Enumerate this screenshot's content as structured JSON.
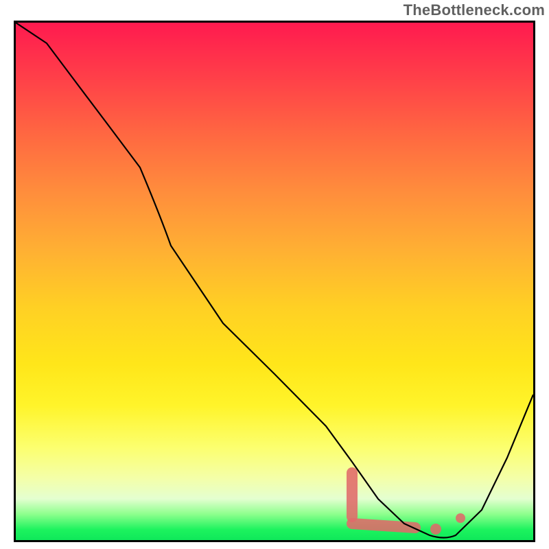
{
  "watermark": "TheBottleneck.com",
  "chart_data": {
    "type": "line",
    "title": "",
    "xlabel": "",
    "ylabel": "",
    "xlim": [
      0,
      100
    ],
    "ylim": [
      0,
      100
    ],
    "background_gradient": {
      "orientation": "vertical",
      "stops": [
        {
          "pct": 0,
          "color": "#ff1a4f"
        },
        {
          "pct": 10,
          "color": "#ff3d49"
        },
        {
          "pct": 22,
          "color": "#ff6941"
        },
        {
          "pct": 33,
          "color": "#ff8e3c"
        },
        {
          "pct": 44,
          "color": "#ffb033"
        },
        {
          "pct": 55,
          "color": "#ffd024"
        },
        {
          "pct": 66,
          "color": "#ffe61a"
        },
        {
          "pct": 74,
          "color": "#fff42a"
        },
        {
          "pct": 82,
          "color": "#fcff6e"
        },
        {
          "pct": 88,
          "color": "#f4ffa8"
        },
        {
          "pct": 92,
          "color": "#e4ffd0"
        },
        {
          "pct": 95,
          "color": "#8dff8d"
        },
        {
          "pct": 98,
          "color": "#1cf35e"
        },
        {
          "pct": 100,
          "color": "#0fe85a"
        }
      ]
    },
    "series": [
      {
        "name": "bottleneck-curve",
        "x": [
          0,
          6,
          12,
          18,
          24,
          30,
          40,
          50,
          60,
          65,
          70,
          75,
          80,
          85,
          90,
          95,
          100
        ],
        "y": [
          100,
          96,
          88,
          80,
          72,
          57,
          42,
          32,
          22,
          15,
          8,
          3,
          1,
          0,
          6,
          16,
          28
        ]
      }
    ],
    "annotations": [
      {
        "name": "red-smear-vertical",
        "type": "segment",
        "color": "#e06a6a",
        "x": [
          65,
          65
        ],
        "y": [
          13,
          4
        ]
      },
      {
        "name": "red-smear-horizontal",
        "type": "segment",
        "color": "#e06a6a",
        "x": [
          65,
          77
        ],
        "y": [
          3,
          2
        ]
      },
      {
        "name": "red-dot-1",
        "type": "point",
        "color": "#e06a6a",
        "x": 81,
        "y": 2
      },
      {
        "name": "red-dot-2",
        "type": "point",
        "color": "#e06a6a",
        "x": 86,
        "y": 4
      }
    ]
  }
}
